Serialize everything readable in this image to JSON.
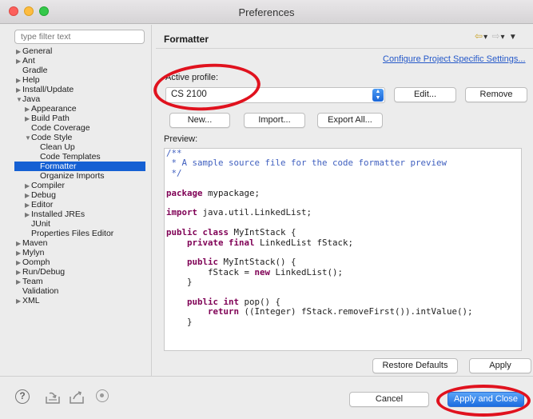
{
  "window": {
    "title": "Preferences"
  },
  "sidebar": {
    "filter_placeholder": "type filter text",
    "items": [
      {
        "label": "General",
        "level": 0,
        "arrow": "right"
      },
      {
        "label": "Ant",
        "level": 0,
        "arrow": "right"
      },
      {
        "label": "Gradle",
        "level": 0,
        "arrow": "none"
      },
      {
        "label": "Help",
        "level": 0,
        "arrow": "right"
      },
      {
        "label": "Install/Update",
        "level": 0,
        "arrow": "right"
      },
      {
        "label": "Java",
        "level": 0,
        "arrow": "down"
      },
      {
        "label": "Appearance",
        "level": 1,
        "arrow": "right"
      },
      {
        "label": "Build Path",
        "level": 1,
        "arrow": "right"
      },
      {
        "label": "Code Coverage",
        "level": 1,
        "arrow": "none"
      },
      {
        "label": "Code Style",
        "level": 1,
        "arrow": "down"
      },
      {
        "label": "Clean Up",
        "level": 2,
        "arrow": "none"
      },
      {
        "label": "Code Templates",
        "level": 2,
        "arrow": "none"
      },
      {
        "label": "Formatter",
        "level": 2,
        "arrow": "none",
        "selected": true
      },
      {
        "label": "Organize Imports",
        "level": 2,
        "arrow": "none"
      },
      {
        "label": "Compiler",
        "level": 1,
        "arrow": "right"
      },
      {
        "label": "Debug",
        "level": 1,
        "arrow": "right"
      },
      {
        "label": "Editor",
        "level": 1,
        "arrow": "right"
      },
      {
        "label": "Installed JREs",
        "level": 1,
        "arrow": "right"
      },
      {
        "label": "JUnit",
        "level": 1,
        "arrow": "none"
      },
      {
        "label": "Properties Files Editor",
        "level": 1,
        "arrow": "none"
      },
      {
        "label": "Maven",
        "level": 0,
        "arrow": "right"
      },
      {
        "label": "Mylyn",
        "level": 0,
        "arrow": "right"
      },
      {
        "label": "Oomph",
        "level": 0,
        "arrow": "right"
      },
      {
        "label": "Run/Debug",
        "level": 0,
        "arrow": "right"
      },
      {
        "label": "Team",
        "level": 0,
        "arrow": "right"
      },
      {
        "label": "Validation",
        "level": 0,
        "arrow": "none"
      },
      {
        "label": "XML",
        "level": 0,
        "arrow": "right"
      }
    ]
  },
  "page": {
    "title": "Formatter",
    "configure_link": "Configure Project Specific Settings...",
    "active_profile_label": "Active profile:",
    "active_profile_value": "CS 2100",
    "edit_label": "Edit...",
    "remove_label": "Remove",
    "new_label": "New...",
    "import_label": "Import...",
    "export_label": "Export All...",
    "preview_label": "Preview:",
    "preview_lines": [
      [
        {
          "t": "/**",
          "c": "cm"
        }
      ],
      [
        {
          "t": " * A sample source file for the code formatter preview",
          "c": "cm"
        }
      ],
      [
        {
          "t": " */",
          "c": "cm"
        }
      ],
      [],
      [
        {
          "t": "package",
          "c": "kw"
        },
        {
          "t": " mypackage;",
          "c": ""
        }
      ],
      [],
      [
        {
          "t": "import",
          "c": "kw"
        },
        {
          "t": " java.util.LinkedList;",
          "c": ""
        }
      ],
      [],
      [
        {
          "t": "public class",
          "c": "kw"
        },
        {
          "t": " MyIntStack {",
          "c": ""
        }
      ],
      [
        {
          "t": "    ",
          "c": ""
        },
        {
          "t": "private final",
          "c": "kw"
        },
        {
          "t": " LinkedList fStack;",
          "c": ""
        }
      ],
      [],
      [
        {
          "t": "    ",
          "c": ""
        },
        {
          "t": "public",
          "c": "kw"
        },
        {
          "t": " MyIntStack() {",
          "c": ""
        }
      ],
      [
        {
          "t": "        fStack = ",
          "c": ""
        },
        {
          "t": "new",
          "c": "kw"
        },
        {
          "t": " LinkedList();",
          "c": ""
        }
      ],
      [
        {
          "t": "    }",
          "c": ""
        }
      ],
      [],
      [
        {
          "t": "    ",
          "c": ""
        },
        {
          "t": "public int",
          "c": "kw"
        },
        {
          "t": " pop() {",
          "c": ""
        }
      ],
      [
        {
          "t": "        ",
          "c": ""
        },
        {
          "t": "return",
          "c": "kw"
        },
        {
          "t": " ((Integer) fStack.removeFirst()).intValue();",
          "c": ""
        }
      ],
      [
        {
          "t": "    }",
          "c": ""
        }
      ]
    ],
    "restore_defaults_label": "Restore Defaults",
    "apply_label": "Apply"
  },
  "footer": {
    "help_glyph": "?",
    "icons": [
      "help-icon",
      "import-icon",
      "export-icon",
      "record-icon"
    ],
    "cancel_label": "Cancel",
    "apply_close_label": "Apply and Close"
  },
  "colors": {
    "accent": "#1c6de0",
    "selection": "#1560d3",
    "annotation_ring": "#e0121e",
    "link": "#2559c9",
    "comment": "#3f5fbf",
    "keyword": "#7f0055"
  }
}
